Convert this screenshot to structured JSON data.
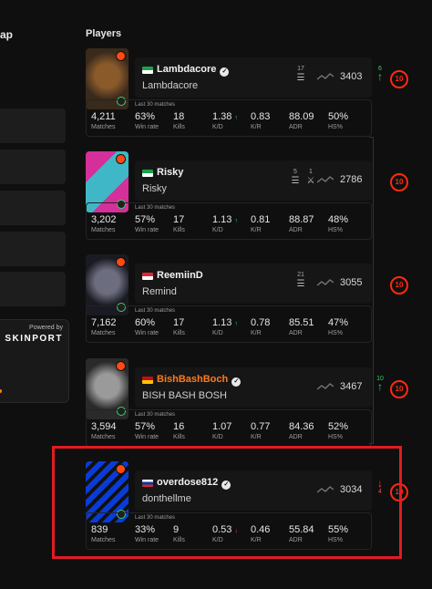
{
  "left_panel": {
    "title_fragment": "ap",
    "sponsor": {
      "powered_by": "Powered by",
      "brand": "SKINPORT"
    }
  },
  "section_title": "Players",
  "stats_caption": "Last 30 matches",
  "stat_labels": [
    "Matches",
    "Win rate",
    "Kills",
    "K/D",
    "K/R",
    "ADR",
    "HS%"
  ],
  "players": [
    {
      "name": "Lambdacore",
      "nickname": "Lambdacore",
      "verified": true,
      "flag_colors": [
        "#1aa34a",
        "#ffffff"
      ],
      "name_color": "#f2f2f2",
      "history": [
        {
          "count": "17",
          "icon": "handshake-icon"
        }
      ],
      "elo": "3403",
      "elo_change": "6",
      "elo_direction": "up",
      "level": "10",
      "matches": "4,211",
      "win_rate": "63%",
      "kills": "18",
      "kd": "1.38",
      "kd_trend": "up",
      "kr": "0.83",
      "adr": "88.09",
      "hs": "50%",
      "avatar_colors": [
        "#3a2a1c",
        "#8a5a2a"
      ]
    },
    {
      "name": "Risky",
      "nickname": "Risky",
      "verified": false,
      "flag_colors": [
        "#1aa34a",
        "#ffffff"
      ],
      "name_color": "#f2f2f2",
      "history": [
        {
          "count": "5",
          "icon": "handshake-icon"
        },
        {
          "count": "1",
          "icon": "crossed-swords-icon"
        }
      ],
      "elo": "2786",
      "elo_change": "",
      "elo_direction": "",
      "level": "10",
      "matches": "3,202",
      "win_rate": "57%",
      "kills": "17",
      "kd": "1.13",
      "kd_trend": "up",
      "kr": "0.81",
      "adr": "88.87",
      "hs": "48%",
      "avatar_colors": [
        "#d42f9a",
        "#3fb7c6"
      ]
    },
    {
      "name": "ReemiinD",
      "nickname": "Remind",
      "verified": false,
      "flag_colors": [
        "#e4243a",
        "#ffffff"
      ],
      "name_color": "#f2f2f2",
      "history": [
        {
          "count": "21",
          "icon": "handshake-icon"
        }
      ],
      "elo": "3055",
      "elo_change": "",
      "elo_direction": "",
      "level": "10",
      "matches": "7,162",
      "win_rate": "60%",
      "kills": "17",
      "kd": "1.13",
      "kd_trend": "up",
      "kr": "0.78",
      "adr": "85.51",
      "hs": "47%",
      "avatar_colors": [
        "#1a1a22",
        "#6d6d80"
      ]
    },
    {
      "name": "BishBashBoch",
      "nickname": "BISH BASH BOSH",
      "verified": true,
      "flag_colors": [
        "#c60b1e",
        "#ffc400"
      ],
      "name_color": "#ff7a1a",
      "history": [],
      "elo": "3467",
      "elo_change": "10",
      "elo_direction": "up",
      "level": "10",
      "matches": "3,594",
      "win_rate": "57%",
      "kills": "16",
      "kd": "1.07",
      "kd_trend": "",
      "kr": "0.77",
      "adr": "84.36",
      "hs": "52%",
      "avatar_colors": [
        "#2a2a2a",
        "#9a9a9a"
      ]
    },
    {
      "name": "overdose812",
      "nickname": "donthellme",
      "verified": true,
      "flag_colors": [
        "#ffffff",
        "#d52b1e"
      ],
      "name_color": "#f2f2f2",
      "history": [],
      "elo": "3034",
      "elo_change": "4",
      "elo_direction": "down",
      "level": "10",
      "matches": "839",
      "win_rate": "33%",
      "kills": "9",
      "kd": "0.53",
      "kd_trend": "down",
      "kr": "0.46",
      "adr": "55.84",
      "hs": "55%",
      "avatar_colors": [
        "#0a3bd6",
        "#111111"
      ]
    }
  ]
}
